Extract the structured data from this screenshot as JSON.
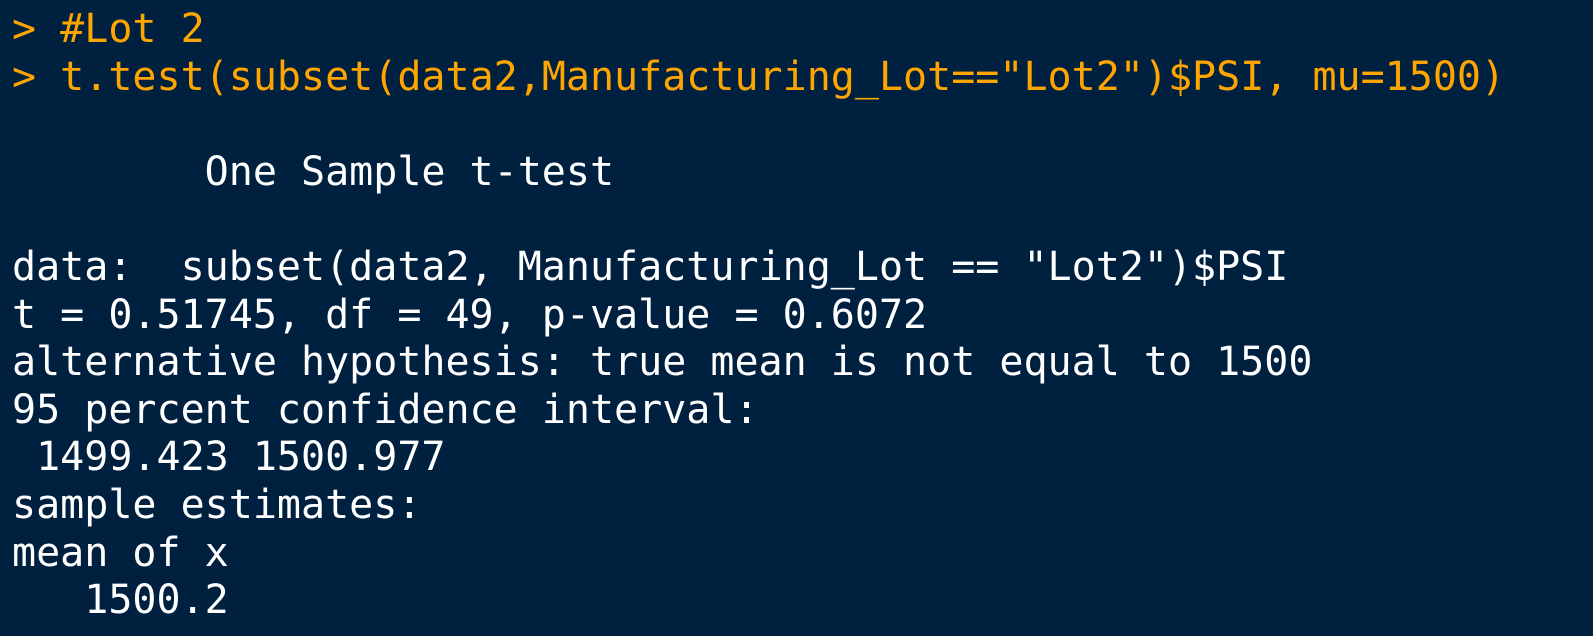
{
  "console": {
    "input": [
      {
        "prompt": "> ",
        "code": "#Lot 2"
      },
      {
        "prompt": "> ",
        "code": "t.test(subset(data2,Manufacturing_Lot==\"Lot2\")$PSI, mu=1500)"
      }
    ],
    "output": [
      "",
      "        One Sample t-test",
      "",
      "data:  subset(data2, Manufacturing_Lot == \"Lot2\")$PSI",
      "t = 0.51745, df = 49, p-value = 0.6072",
      "alternative hypothesis: true mean is not equal to 1500",
      "95 percent confidence interval:",
      " 1499.423 1500.977",
      "sample estimates:",
      "mean of x",
      "   1500.2"
    ]
  },
  "colors": {
    "background": "#002040",
    "command_text": "#FFA500",
    "output_text": "#FFFFFF"
  }
}
